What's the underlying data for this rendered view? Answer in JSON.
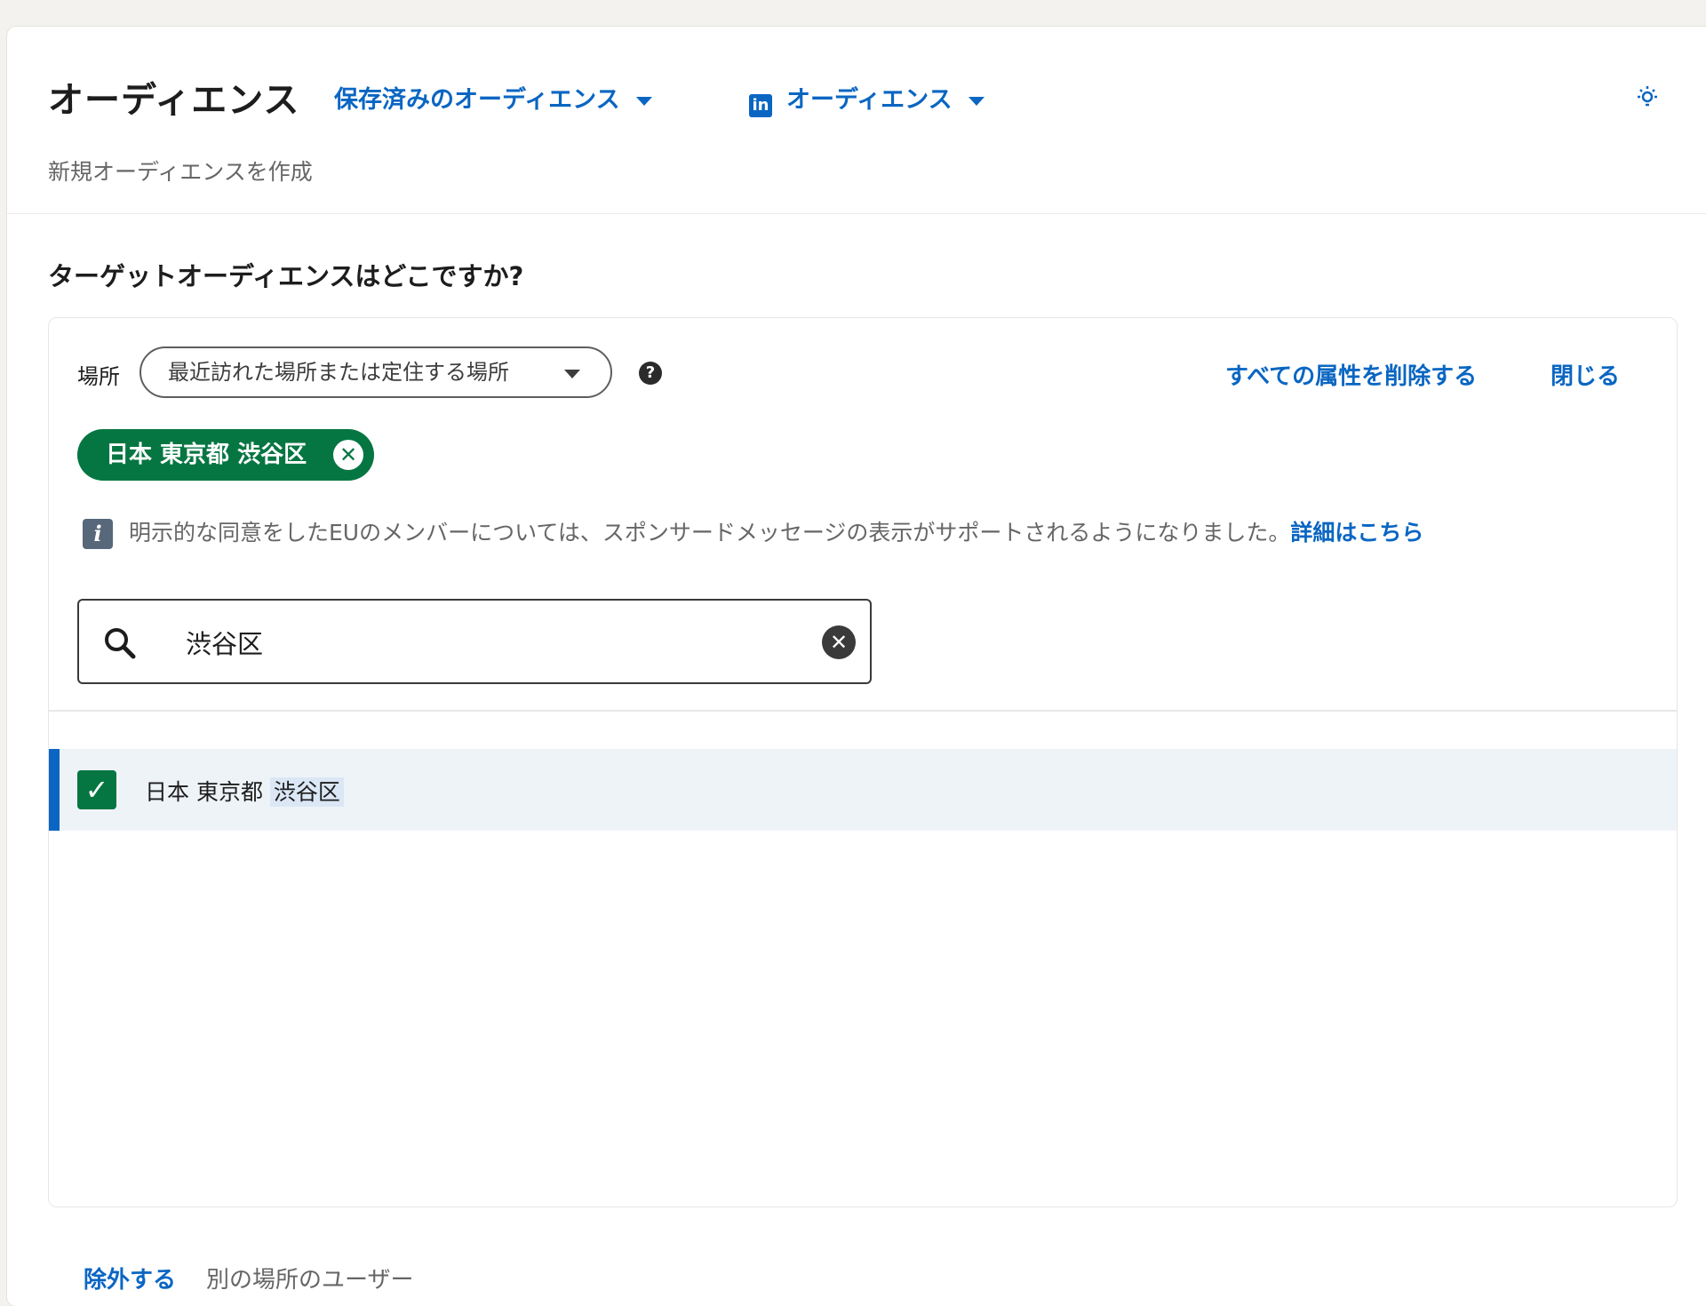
{
  "header": {
    "title": "オーディエンス",
    "saved_audiences": "保存済みのオーディエンス",
    "linkedin_audience": "オーディエンス",
    "linkedin_logo_text": "in",
    "subtitle": "新規オーディエンスを作成",
    "icons": {
      "bulb": "lightbulb-icon",
      "dropdown": "chevron-down-icon"
    }
  },
  "question": "ターゲットオーディエンスはどこですか?",
  "location": {
    "label": "場所",
    "select_value": "最近訪れた場所または定住する場所",
    "help": "?",
    "remove_all": "すべての属性を削除する",
    "close": "閉じる"
  },
  "selected_pill": {
    "label": "日本 東京都 渋谷区",
    "remove": "✕"
  },
  "info": {
    "icon": "i",
    "text": "明示的な同意をしたEUのメンバーについては、スポンサードメッセージの表示がサポートされるようになりました。",
    "link": "詳細はこちら"
  },
  "search": {
    "value": "渋谷区",
    "clear": "✕"
  },
  "results": [
    {
      "prefix": "日本 東京都",
      "match": "渋谷区",
      "checked": true,
      "check_mark": "✓"
    }
  ],
  "footer": {
    "exclude": "除外する",
    "exclude_desc": "別の場所のユーザー"
  },
  "colors": {
    "accent": "#0a66c2",
    "green": "#057642",
    "text": "#1d1d1d",
    "muted": "#666666"
  }
}
